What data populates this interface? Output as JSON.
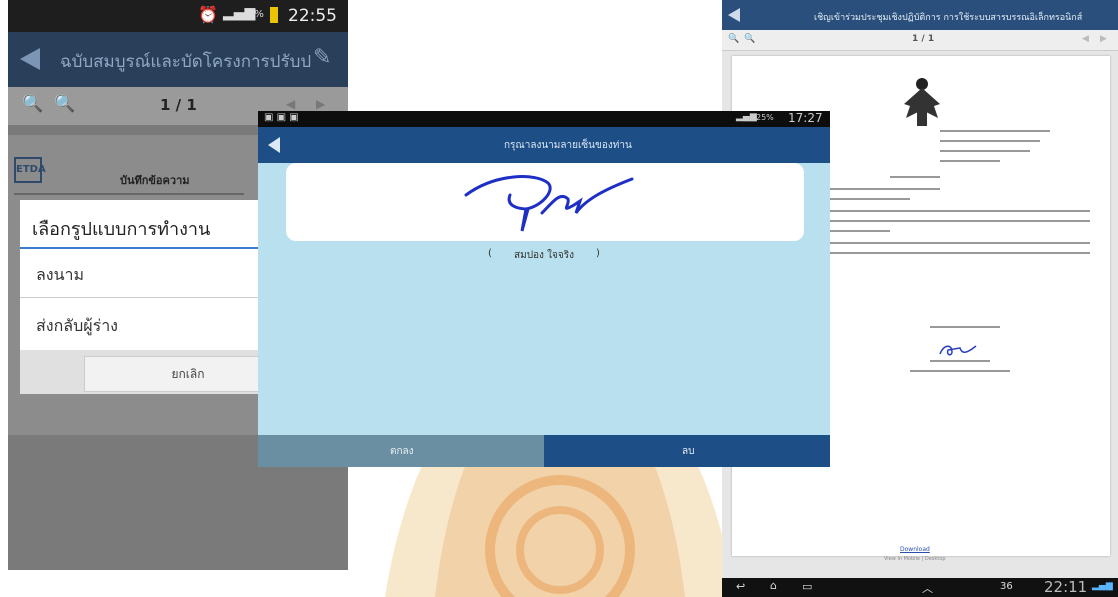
{
  "phone1": {
    "status_time": "22:55",
    "status_battery": "5%",
    "app_title": "ฉบับสมบูรณ์และบัดโครงการปรับป",
    "page_indicator": "1 / 1",
    "doc_heading": "บันทึกข้อความ",
    "dialog": {
      "title": "เลือกรูปแบบการทำงาน",
      "options": [
        "ลงนาม",
        "ส่งกลับผู้ร่าง"
      ],
      "cancel_label": "ยกเลิก"
    }
  },
  "tablet": {
    "status_time": "17:27",
    "status_battery": "25%",
    "title": "กรุณาลงนามลายเซ็นของท่าน",
    "signer_open": "(",
    "signer_name": "สมปอง ใจจริง",
    "signer_close": ")",
    "ok_label": "ตกลง",
    "clear_label": "ลบ"
  },
  "doc": {
    "title": "เชิญเข้าร่วมประชุมเชิงปฏิบัติการ การใช้ระบบสารบรรณอิเล็กทรอนิกส์",
    "page_indicator": "1 / 1",
    "download_label": "Download",
    "view_label": "View in Mobile | Desktop",
    "nav_time": "22:11",
    "nav_count": "36"
  },
  "colors": {
    "phone_bar": "#2a3f5a",
    "tablet_bar": "#1e4e86",
    "tablet_bg": "#b9e0ee",
    "signature": "#1d2fc4"
  }
}
